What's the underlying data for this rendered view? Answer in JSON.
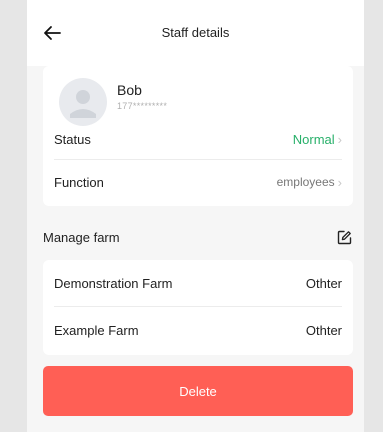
{
  "header": {
    "title": "Staff details",
    "back_icon": "arrow-left-icon"
  },
  "profile": {
    "name": "Bob",
    "phone": "177*********"
  },
  "status": {
    "label": "Status",
    "value": "Normal",
    "value_color": "#28b06a"
  },
  "function": {
    "label": "Function",
    "value": "employees"
  },
  "manage_farm": {
    "title": "Manage farm",
    "edit_icon": "edit-icon",
    "farms": [
      {
        "name": "Demonstration Farm",
        "role": "Othter"
      },
      {
        "name": "Example Farm",
        "role": "Othter"
      }
    ]
  },
  "actions": {
    "delete_label": "Delete",
    "delete_color": "#ff5f55"
  }
}
